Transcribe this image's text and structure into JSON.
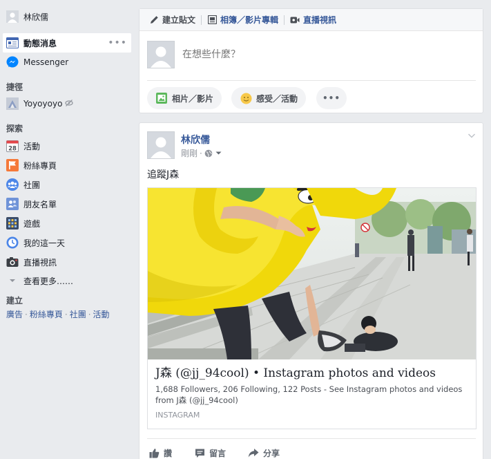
{
  "user": {
    "name": "林欣儒"
  },
  "leftnav": {
    "items": [
      {
        "label": "動態消息",
        "icon": "news-feed-icon",
        "more": "•••"
      },
      {
        "label": "Messenger",
        "icon": "messenger-icon"
      }
    ],
    "shortcuts_header": "捷徑",
    "shortcuts": [
      {
        "label": "Yoyoyoyo",
        "icon": "page-icon"
      }
    ],
    "explore_header": "探索",
    "explore": [
      {
        "label": "活動",
        "icon": "calendar-icon",
        "badge": "28"
      },
      {
        "label": "粉絲專頁",
        "icon": "flag-icon"
      },
      {
        "label": "社團",
        "icon": "groups-icon"
      },
      {
        "label": "朋友名單",
        "icon": "friends-list-icon"
      },
      {
        "label": "遊戲",
        "icon": "games-icon"
      },
      {
        "label": "我的這一天",
        "icon": "memories-icon"
      },
      {
        "label": "直播視訊",
        "icon": "live-video-icon"
      }
    ],
    "see_more": "查看更多……",
    "create_header": "建立",
    "create_links": [
      "廣告",
      "粉絲專頁",
      "社團",
      "活動"
    ]
  },
  "composer": {
    "tabs": [
      {
        "label": "建立貼文",
        "icon": "pencil-icon"
      },
      {
        "label": "相簿／影片專輯",
        "icon": "album-icon"
      },
      {
        "label": "直播視訊",
        "icon": "video-camera-icon"
      }
    ],
    "placeholder": "在想些什麼？",
    "pills": [
      {
        "label": "相片／影片",
        "icon": "photo-icon"
      },
      {
        "label": "感受／活動",
        "icon": "smiley-icon"
      }
    ],
    "more": "•••"
  },
  "post": {
    "author": "林欣儒",
    "time": "剛剛",
    "privacy_icon": "globe-icon",
    "text": "追蹤J森",
    "link": {
      "title": "J森 (@jj_94cool) • Instagram photos and videos",
      "description": "1,688 Followers, 206 Following, 122 Posts - See Instagram photos and videos from J森 (@jj_94cool)",
      "source": "INSTAGRAM"
    },
    "actions": [
      {
        "label": "讚",
        "icon": "like-icon"
      },
      {
        "label": "留言",
        "icon": "comment-icon"
      },
      {
        "label": "分享",
        "icon": "share-icon"
      }
    ]
  },
  "colors": {
    "link": "#365899",
    "bg": "#e9ebee",
    "accent": "#4267b2"
  }
}
